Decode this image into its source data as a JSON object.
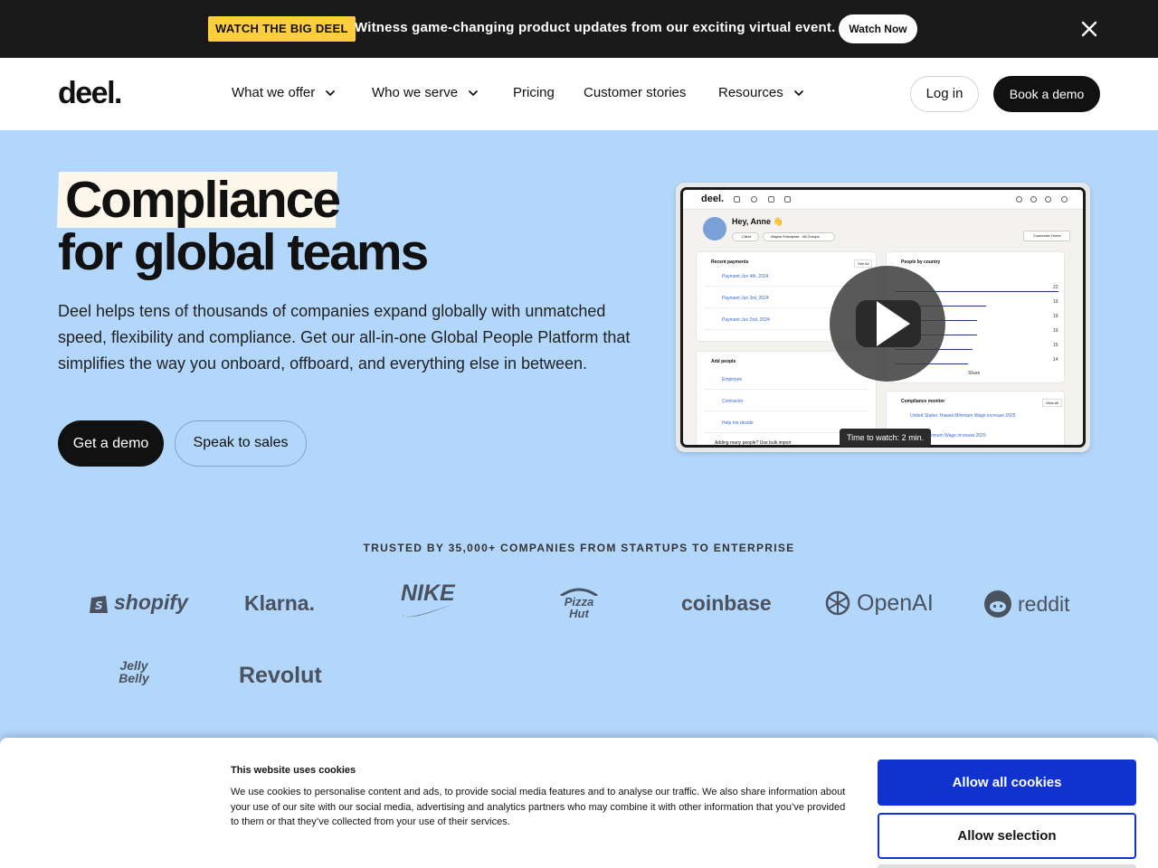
{
  "announcement": {
    "badge": "WATCH THE BIG DEEL",
    "message": "Witness game-changing product updates from our exciting virtual event.",
    "watch_label": "Watch Now",
    "close_icon": "close-icon"
  },
  "nav": {
    "logo": "deel.",
    "items": [
      {
        "label": "What we offer",
        "dropdown": true
      },
      {
        "label": "Who we serve",
        "dropdown": true
      },
      {
        "label": "Pricing",
        "dropdown": false
      },
      {
        "label": "Customer stories",
        "dropdown": false
      },
      {
        "label": "Resources",
        "dropdown": true
      }
    ],
    "login_label": "Log in",
    "demo_label": "Book a demo"
  },
  "hero": {
    "title_highlight": "Compliance",
    "title_rest": "for global teams",
    "description": "Deel helps tens of thousands of companies expand globally with unmatched speed, flexibility and compliance. Get our all-in-one Global People Platform that simplifies the way you onboard, offboard, and everything else in between.",
    "cta_primary": "Get a demo",
    "cta_secondary": "Speak to sales"
  },
  "video": {
    "app_logo": "deel.",
    "greeting": "Hey, Anne 👋",
    "client_pill": "Client",
    "org_pill": "Wayne Enterprise · All Groups",
    "customize_label": "Customize Home",
    "recent_payments_title": "Recent payments",
    "payments": [
      "Payment Jun 4th, 2024",
      "Payment Jun 3rd, 2024",
      "Payment Jun 2nd, 2024"
    ],
    "people_by_country_title": "People by country",
    "people_counts": [
      "22",
      "19",
      "19",
      "19",
      "15",
      "14"
    ],
    "add_people_title": "Add people",
    "add_people_items": [
      "Employee",
      "Contractor",
      "Help me decide"
    ],
    "compliance_title": "Compliance monitor",
    "compliance_items": [
      "United States: Hawaii Minimum Wage increase 2025",
      "Hawaii Minimum Wage increase 2025"
    ],
    "see_all": "See All",
    "view_all": "View All",
    "share": "Share",
    "bulk_import": "Adding many people? Use bulk import",
    "time_to_watch": "Time to watch: 2 min.",
    "play_icon": "play-icon"
  },
  "trusted": {
    "label": "TRUSTED BY 35,000+ COMPANIES FROM STARTUPS TO ENTERPRISE",
    "logos": [
      "shopify",
      "Klarna.",
      "NIKE",
      "Pizza Hut",
      "coinbase",
      "OpenAI",
      "reddit",
      "Jelly Belly",
      "Revolut"
    ]
  },
  "cookie": {
    "title": "This website uses cookies",
    "body": "We use cookies to personalise content and ads, to provide social media features and to analyse our traffic. We also share information about your use of our site with our social media, advertising and analytics partners who may combine it with other information that you’ve provided to them or that they’ve collected from your use of their services.",
    "allow_all": "Allow all cookies",
    "allow_selection": "Allow selection"
  },
  "colors": {
    "hero_bg": "#b3d7fa",
    "announce_bg": "#1a1a1a",
    "badge_bg": "#ffce3d",
    "cookie_accent": "#1032cf"
  }
}
